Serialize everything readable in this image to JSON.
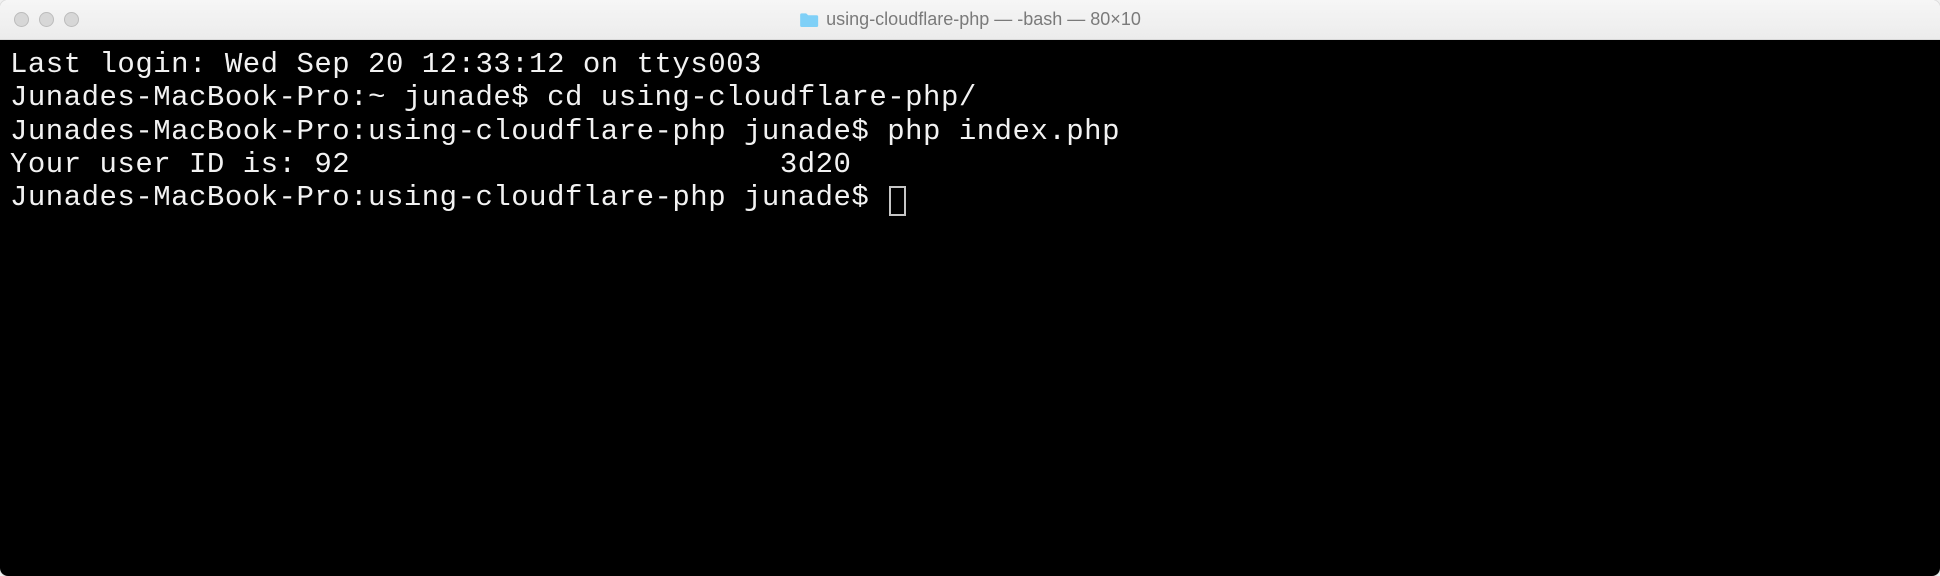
{
  "window": {
    "title": "using-cloudflare-php — -bash — 80×10"
  },
  "terminal": {
    "lines": {
      "l0": "Last login: Wed Sep 20 12:33:12 on ttys003",
      "l1": "Junades-MacBook-Pro:~ junade$ cd using-cloudflare-php/",
      "l2": "Junades-MacBook-Pro:using-cloudflare-php junade$ php index.php",
      "l3": "Your user ID is: 92                        3d20",
      "l4_prompt": "Junades-MacBook-Pro:using-cloudflare-php junade$ "
    }
  }
}
